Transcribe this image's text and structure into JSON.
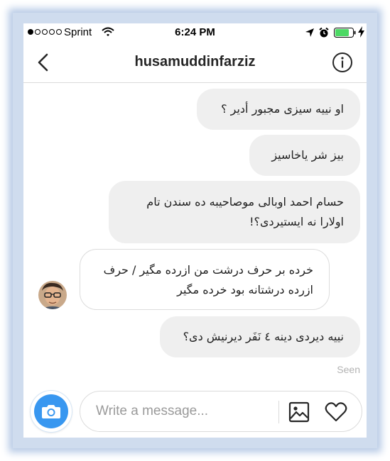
{
  "status_bar": {
    "carrier": "Sprint",
    "time": "6:24 PM",
    "signal_bars_filled": 1,
    "signal_bars_total": 5
  },
  "header": {
    "title": "husamuddinfarziz"
  },
  "messages": [
    {
      "direction": "sent",
      "lines": [
        "او نییه سیزی مجبور أدیر ؟"
      ]
    },
    {
      "direction": "sent",
      "lines": [
        "بیز شر یاخاسیز"
      ]
    },
    {
      "direction": "sent",
      "lines": [
        "حسام احمد اوبالی موصاحیبه ده سندن تام",
        "اولارا نه ایستیردی؟!"
      ]
    },
    {
      "direction": "received",
      "lines": [
        "خرده بر حرف درشت من ازرده مگیر / حرف",
        "ازرده درشتانه بود خرده مگیر"
      ]
    },
    {
      "direction": "sent",
      "lines": [
        "نییه دیردی دینه ٤ نَفَر دیرنیش دی؟"
      ]
    }
  ],
  "seen_label": "Seen",
  "composer": {
    "placeholder": "Write a message..."
  },
  "colors": {
    "accent": "#3897f0",
    "sent_bubble": "#efefef",
    "battery_fill": "#4cd964"
  },
  "icons": {
    "back": "chevron-left-icon",
    "info": "info-icon",
    "camera": "camera-icon",
    "gallery": "image-icon",
    "like": "heart-icon"
  }
}
